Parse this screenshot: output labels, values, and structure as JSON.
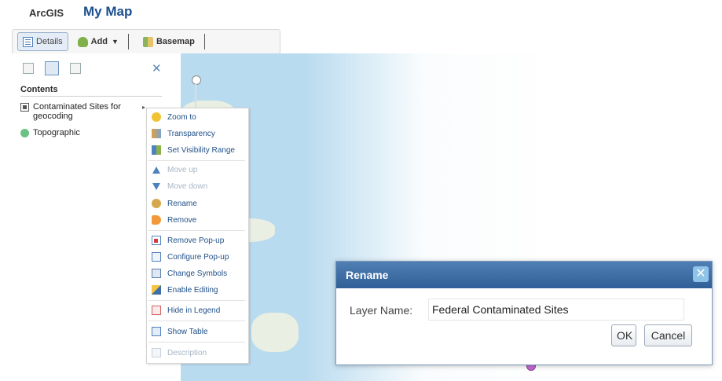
{
  "app": {
    "brand": "ArcGIS",
    "map_title": "My Map"
  },
  "toolbar": {
    "details_label": "Details",
    "add_label": "Add",
    "basemap_label": "Basemap"
  },
  "contents": {
    "heading": "Contents",
    "layers": [
      {
        "name": "Contaminated Sites for geocoding",
        "icon": "filter-icon"
      },
      {
        "name": "Topographic",
        "icon": "globe-icon"
      }
    ]
  },
  "layer_menu": {
    "items": [
      {
        "label": "Zoom to",
        "icon": "zoom-icon",
        "enabled": true
      },
      {
        "label": "Transparency",
        "icon": "transparency-icon",
        "enabled": true
      },
      {
        "label": "Set Visibility Range",
        "icon": "visibility-range-icon",
        "enabled": true
      },
      {
        "label": "Move up",
        "icon": "arrow-up-icon",
        "enabled": false
      },
      {
        "label": "Move down",
        "icon": "arrow-down-icon",
        "enabled": false
      },
      {
        "label": "Rename",
        "icon": "rename-icon",
        "enabled": true
      },
      {
        "label": "Remove",
        "icon": "remove-icon",
        "enabled": true
      },
      {
        "label": "Remove Pop-up",
        "icon": "remove-popup-icon",
        "enabled": true
      },
      {
        "label": "Configure Pop-up",
        "icon": "configure-popup-icon",
        "enabled": true
      },
      {
        "label": "Change Symbols",
        "icon": "symbols-icon",
        "enabled": true
      },
      {
        "label": "Enable Editing",
        "icon": "edit-icon",
        "enabled": true
      },
      {
        "label": "Hide in Legend",
        "icon": "legend-icon",
        "enabled": true
      },
      {
        "label": "Show Table",
        "icon": "table-icon",
        "enabled": true
      },
      {
        "label": "Description",
        "icon": "description-icon",
        "enabled": false
      }
    ]
  },
  "rename_dialog": {
    "title": "Rename",
    "field_label": "Layer Name:",
    "field_value": "Federal Contaminated Sites",
    "ok_label": "OK",
    "cancel_label": "Cancel"
  },
  "colors": {
    "title_blue": "#1c4f8f",
    "dialog_header": "#2f5f96",
    "menu_link": "#1f4f87",
    "map_water": "#b9dbef"
  }
}
